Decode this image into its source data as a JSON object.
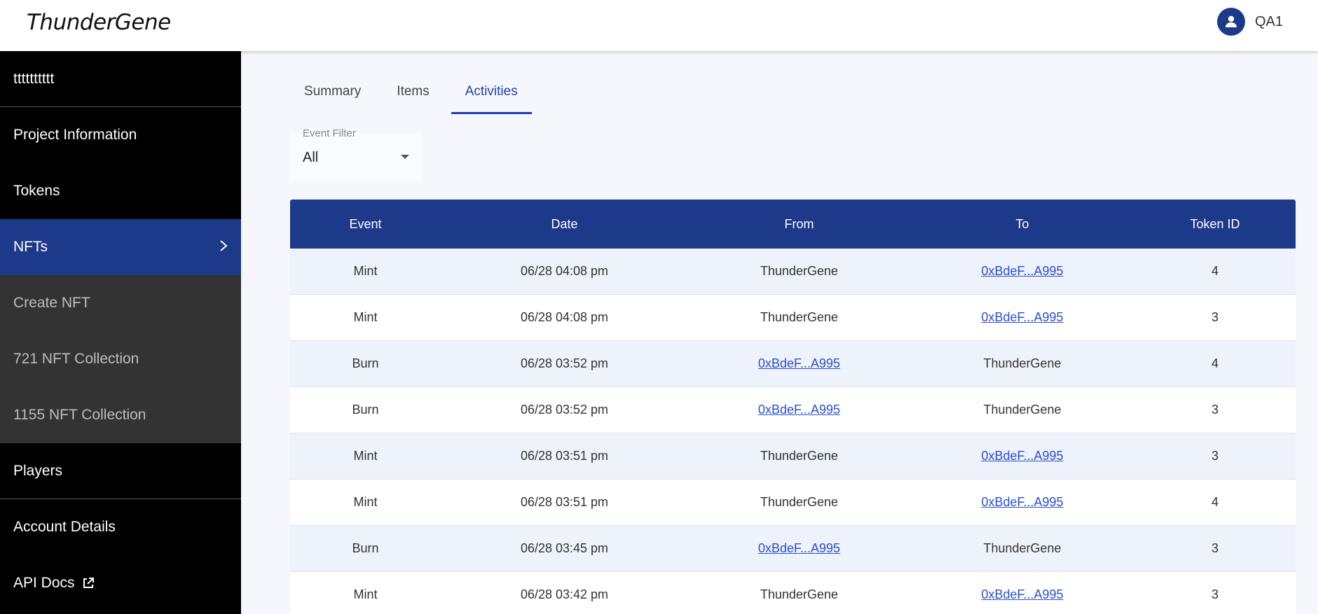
{
  "header": {
    "logo": "ThunderGene",
    "username": "QA1"
  },
  "sidebar": {
    "project": "tttttttttt",
    "items": [
      {
        "label": "Project Information"
      },
      {
        "label": "Tokens"
      },
      {
        "label": "NFTs"
      },
      {
        "label": "Create NFT"
      },
      {
        "label": "721 NFT Collection"
      },
      {
        "label": "1155 NFT Collection"
      },
      {
        "label": "Players"
      },
      {
        "label": "Account Details"
      },
      {
        "label": "API Docs"
      }
    ]
  },
  "tabs": [
    {
      "label": "Summary"
    },
    {
      "label": "Items"
    },
    {
      "label": "Activities"
    }
  ],
  "filter": {
    "label": "Event Filter",
    "value": "All"
  },
  "table": {
    "columns": [
      "Event",
      "Date",
      "From",
      "To",
      "Token ID"
    ],
    "rows": [
      {
        "event": "Mint",
        "date": "06/28 04:08 pm",
        "from": "ThunderGene",
        "to": "0xBdeF...A995",
        "token": "4"
      },
      {
        "event": "Mint",
        "date": "06/28 04:08 pm",
        "from": "ThunderGene",
        "to": "0xBdeF...A995",
        "token": "3"
      },
      {
        "event": "Burn",
        "date": "06/28 03:52 pm",
        "from": "0xBdeF...A995",
        "to": "ThunderGene",
        "token": "4"
      },
      {
        "event": "Burn",
        "date": "06/28 03:52 pm",
        "from": "0xBdeF...A995",
        "to": "ThunderGene",
        "token": "3"
      },
      {
        "event": "Mint",
        "date": "06/28 03:51 pm",
        "from": "ThunderGene",
        "to": "0xBdeF...A995",
        "token": "3"
      },
      {
        "event": "Mint",
        "date": "06/28 03:51 pm",
        "from": "ThunderGene",
        "to": "0xBdeF...A995",
        "token": "4"
      },
      {
        "event": "Burn",
        "date": "06/28 03:45 pm",
        "from": "0xBdeF...A995",
        "to": "ThunderGene",
        "token": "3"
      },
      {
        "event": "Mint",
        "date": "06/28 03:42 pm",
        "from": "ThunderGene",
        "to": "0xBdeF...A995",
        "token": "3"
      }
    ]
  },
  "colors": {
    "brand": "#1d3a8a",
    "accent": "#1d3fb3",
    "link": "#2a4fd1"
  },
  "icons": {
    "avatar": "person-icon",
    "nfts_chevron": "chevron-right-icon",
    "api_docs": "external-link-icon"
  }
}
